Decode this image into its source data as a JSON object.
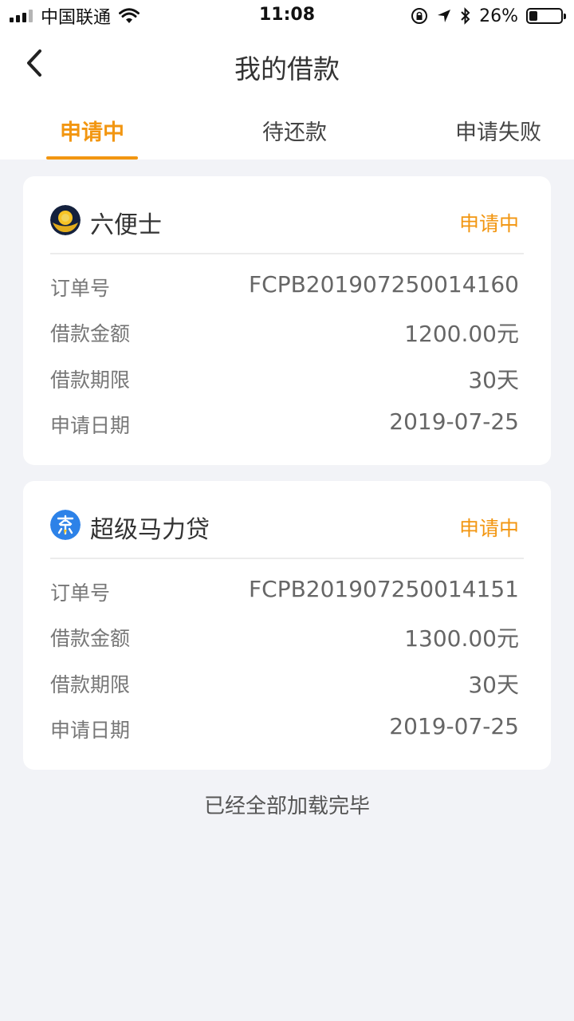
{
  "status_bar": {
    "carrier": "中国联通",
    "time": "11:08",
    "battery": "26%",
    "battery_level": 0.26
  },
  "nav": {
    "title": "我的借款"
  },
  "tabs": [
    {
      "label": "申请中",
      "active": true
    },
    {
      "label": "待还款",
      "active": false
    },
    {
      "label": "申请失败",
      "active": false
    }
  ],
  "accent_color": "#f29611",
  "loans": [
    {
      "name": "六便士",
      "status": "申请中",
      "logo_icon": "six-pence-logo-icon",
      "rows": [
        {
          "label": "订单号",
          "value": "FCPB201907250014160"
        },
        {
          "label": "借款金额",
          "value": "1200.00元"
        },
        {
          "label": "借款期限",
          "value": "30天"
        },
        {
          "label": "申请日期",
          "value": "2019-07-25"
        }
      ]
    },
    {
      "name": "超级马力贷",
      "status": "申请中",
      "logo_icon": "super-mali-loan-logo-icon",
      "rows": [
        {
          "label": "订单号",
          "value": "FCPB201907250014151"
        },
        {
          "label": "借款金额",
          "value": "1300.00元"
        },
        {
          "label": "借款期限",
          "value": "30天"
        },
        {
          "label": "申请日期",
          "value": "2019-07-25"
        }
      ]
    }
  ],
  "footer": "已经全部加载完毕"
}
